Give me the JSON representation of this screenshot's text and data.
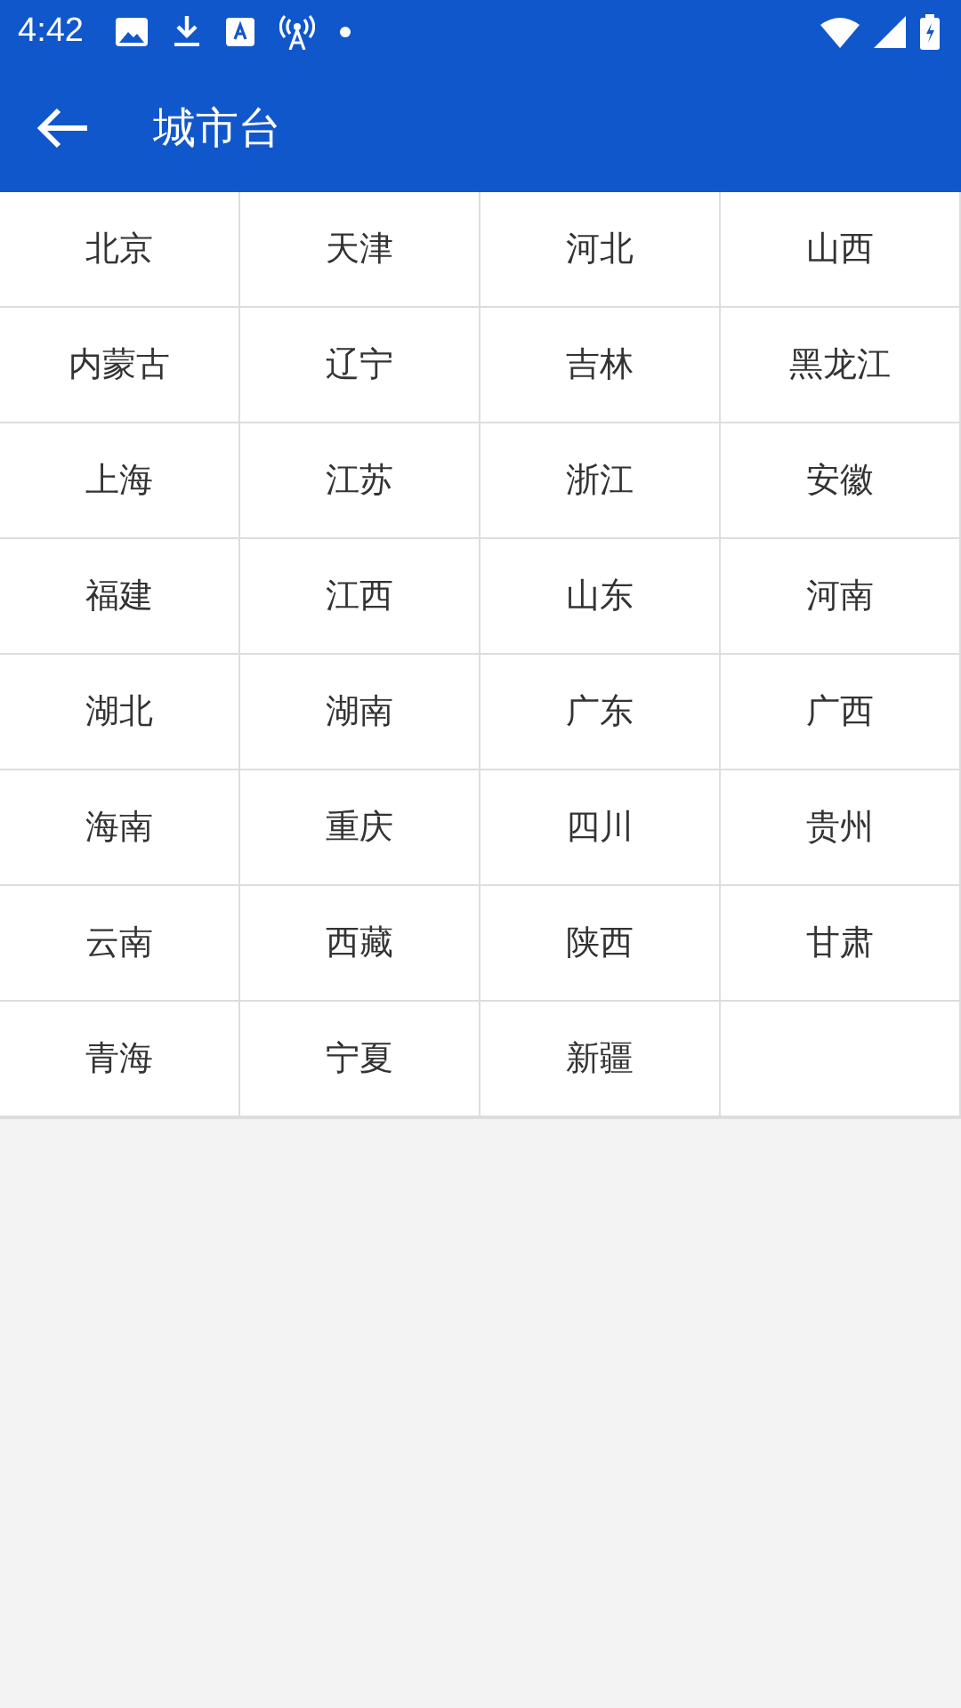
{
  "status_bar": {
    "time": "4:42"
  },
  "app_bar": {
    "title": "城市台"
  },
  "regions": [
    "北京",
    "天津",
    "河北",
    "山西",
    "内蒙古",
    "辽宁",
    "吉林",
    "黑龙江",
    "上海",
    "江苏",
    "浙江",
    "安徽",
    "福建",
    "江西",
    "山东",
    "河南",
    "湖北",
    "湖南",
    "广东",
    "广西",
    "海南",
    "重庆",
    "四川",
    "贵州",
    "云南",
    "西藏",
    "陕西",
    "甘肃",
    "青海",
    "宁夏",
    "新疆"
  ]
}
